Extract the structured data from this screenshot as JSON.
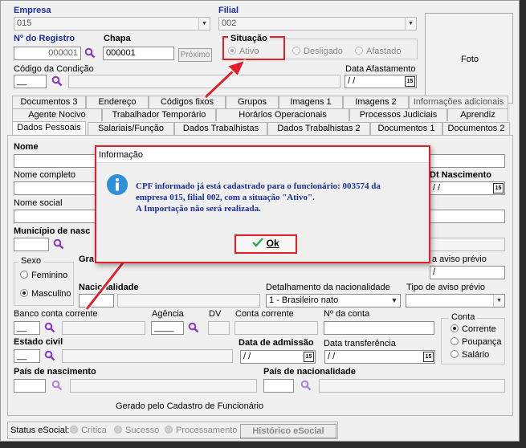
{
  "header": {
    "empresa_label": "Empresa",
    "empresa_value": "015",
    "filial_label": "Filial",
    "filial_value": "002",
    "registro_label": "Nº do Registro",
    "registro_value": "000001",
    "chapa_label": "Chapa",
    "chapa_value": "000001",
    "proximo_label": "Próximo",
    "situacao_label": "Situação",
    "situacao_options": [
      "Ativo",
      "Desligado",
      "Afastado"
    ],
    "situacao_selected": "Ativo",
    "codigo_condicao_label": "Código da Condição",
    "codigo_condicao_value": "__",
    "data_afastamento_label": "Data Afastamento",
    "data_afastamento_value": " / /",
    "foto_label": "Foto"
  },
  "tabs": {
    "row1": [
      "Documentos 3",
      "Endereço",
      "Códigos fixos",
      "Grupos",
      "Imagens 1",
      "Imagens 2",
      "Informações adicionais"
    ],
    "row2": [
      "Agente Nocivo",
      "Trabalhador Temporário",
      "Horários Operacionais",
      "Processos Judiciais",
      "Aprendiz"
    ],
    "row3": [
      "Dados Pessoais",
      "Salariais/Função",
      "Dados Trabalhistas",
      "Dados Trabalhistas 2",
      "Documentos 1",
      "Documentos 2"
    ]
  },
  "form": {
    "nome_label": "Nome",
    "nome_completo_label": "Nome completo",
    "nome_social_label": "Nome social",
    "municipio_label": "Município de nasc",
    "dt_nascimento_label": "Dt Nascimento",
    "dt_nascimento_value": " / /",
    "sexo_label": "Sexo",
    "sexo_options": [
      "Feminino",
      "Masculino"
    ],
    "sexo_selected": "Masculino",
    "grau_label": "Gra",
    "aviso_previo_label": "a aviso prévio",
    "aviso_previo_value": "/",
    "nacionalidade_label": "Nacionalidade",
    "detalhamento_label": "Detalhamento da nacionalidade",
    "detalhamento_value": "1 - Brasileiro nato",
    "tipo_aviso_label": "Tipo de aviso prévio",
    "banco_label": "Banco conta corrente",
    "banco_value": "__",
    "agencia_label": "Agência",
    "agencia_value": "____",
    "dv_label": "DV",
    "conta_corrente_label": "Conta corrente",
    "numero_conta_label": "Nº da conta",
    "conta_group_label": "Conta",
    "conta_options": [
      "Corrente",
      "Poupança",
      "Salário"
    ],
    "conta_selected": "Corrente",
    "estado_civil_label": "Estado civil",
    "estado_civil_value": "__",
    "data_admissao_label": "Data de admissão",
    "data_admissao_value": " / /",
    "data_transferencia_label": "Data transferência",
    "data_transferencia_value": " / /",
    "pais_nascimento_label": "País de nascimento",
    "pais_nacionalidade_label": "País de nacionalidade",
    "gerado_label": "Gerado pelo Cadastro de Funcionário"
  },
  "status_bar": {
    "label": "Status eSocial:",
    "items": [
      "Crítica",
      "Sucesso",
      "Processamento"
    ],
    "historico_button": "Histórico eSocial"
  },
  "dialog": {
    "title": "Informação",
    "line1": "CPF informado já está cadastrado para o funcionário: 003574 da",
    "line2": "empresa 015, filial 002, com a situação \"Ativo\".",
    "line3": "A Importação não será realizada.",
    "ok_label": "Ok",
    "icon": "info-icon"
  },
  "colors": {
    "highlight": "#e3202a",
    "label_blue": "#1a2f9e",
    "info_icon": "#2f8fd8"
  }
}
